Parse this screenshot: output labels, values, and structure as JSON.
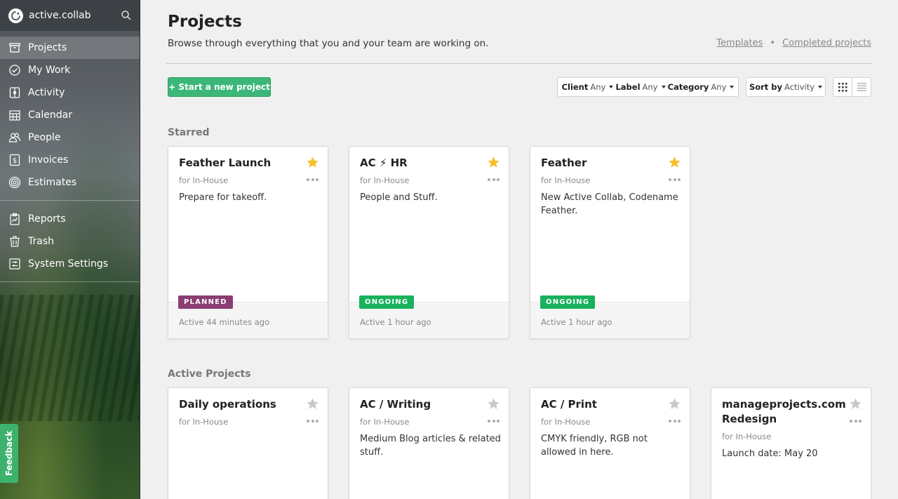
{
  "app": {
    "brand": "active.collab"
  },
  "sidebar": {
    "items": [
      {
        "label": "Projects",
        "icon": "projects-icon",
        "active": true
      },
      {
        "label": "My Work",
        "icon": "check-circle-icon"
      },
      {
        "label": "Activity",
        "icon": "activity-icon"
      },
      {
        "label": "Calendar",
        "icon": "calendar-icon"
      },
      {
        "label": "People",
        "icon": "people-icon"
      },
      {
        "label": "Invoices",
        "icon": "invoices-icon"
      },
      {
        "label": "Estimates",
        "icon": "estimates-icon"
      },
      {
        "label": "Reports",
        "icon": "reports-icon"
      },
      {
        "label": "Trash",
        "icon": "trash-icon"
      },
      {
        "label": "System Settings",
        "icon": "settings-sliders-icon"
      }
    ],
    "feedback_label": "Feedback"
  },
  "header": {
    "title": "Projects",
    "subtitle": "Browse through everything that you and your team are working on.",
    "links": {
      "templates": "Templates",
      "separator": "•",
      "completed": "Completed projects"
    }
  },
  "toolbar": {
    "new_project": "+ Start a new project",
    "filters": [
      {
        "label": "Client",
        "value": "Any"
      },
      {
        "label": "Label",
        "value": "Any"
      },
      {
        "label": "Category",
        "value": "Any"
      }
    ],
    "sort": {
      "label": "Sort by",
      "value": "Activity"
    }
  },
  "sections": {
    "starred": "Starred",
    "active": "Active Projects"
  },
  "starred_projects": [
    {
      "title": "Feather Launch",
      "client": "for In-House",
      "description": "Prepare for takeoff.",
      "status": "PLANNED",
      "status_color": "#8a3d73",
      "activity": "Active 44 minutes ago",
      "starred": true
    },
    {
      "title": "AC ⚡ HR",
      "client": "for In-House",
      "description": "People and Stuff.",
      "status": "ONGOING",
      "status_color": "#18b15c",
      "activity": "Active 1 hour ago",
      "starred": true
    },
    {
      "title": "Feather",
      "client": "for In-House",
      "description": "New Active Collab, Codename Feather.",
      "status": "ONGOING",
      "status_color": "#18b15c",
      "activity": "Active 1 hour ago",
      "starred": true
    }
  ],
  "active_projects": [
    {
      "title": "Daily operations",
      "client": "for In-House",
      "description": "",
      "starred": false
    },
    {
      "title": "AC / Writing",
      "client": "for In-House",
      "description": "Medium Blog articles & related stuff.",
      "starred": false
    },
    {
      "title": "AC / Print",
      "client": "for In-House",
      "description": "CMYK friendly, RGB not allowed in here.",
      "starred": false
    },
    {
      "title": "manageprojects.com Redesign",
      "client": "for In-House",
      "description": "Launch date: May 20",
      "starred": false
    }
  ],
  "colors": {
    "accent": "#3cb779",
    "star_on": "#f5c02b",
    "star_off": "#c8c8c8"
  }
}
